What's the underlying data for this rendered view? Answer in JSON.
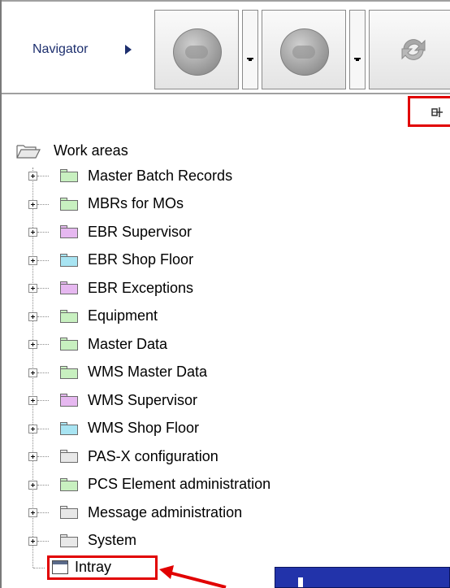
{
  "toolbar": {
    "navigator_label": "Navigator",
    "buttons": [
      {
        "name": "back",
        "has_dropdown": true
      },
      {
        "name": "forward",
        "has_dropdown": true
      },
      {
        "name": "refresh",
        "has_dropdown": false
      }
    ]
  },
  "tree": {
    "root": "Work areas",
    "items": [
      {
        "label": "Master Batch Records",
        "folder_color": "#c8f0c0"
      },
      {
        "label": "MBRs for MOs",
        "folder_color": "#c8f0c0"
      },
      {
        "label": "EBR Supervisor",
        "folder_color": "#e6b8f0"
      },
      {
        "label": "EBR Shop Floor",
        "folder_color": "#a8e4f2"
      },
      {
        "label": "EBR Exceptions",
        "folder_color": "#e6b8f0"
      },
      {
        "label": "Equipment",
        "folder_color": "#c8f0c0"
      },
      {
        "label": "Master Data",
        "folder_color": "#c8f0c0"
      },
      {
        "label": "WMS Master Data",
        "folder_color": "#c8f0c0"
      },
      {
        "label": "WMS Supervisor",
        "folder_color": "#e6b8f0"
      },
      {
        "label": "WMS Shop Floor",
        "folder_color": "#a8e4f2"
      },
      {
        "label": "PAS-X configuration",
        "folder_color": "#e8e8e8"
      },
      {
        "label": "PCS Element administration",
        "folder_color": "#c8f0c0"
      },
      {
        "label": "Message administration",
        "folder_color": "#e8e8e8"
      },
      {
        "label": "System",
        "folder_color": "#e8e8e8"
      }
    ],
    "leaf": {
      "label": "Intray"
    }
  },
  "colors": {
    "highlight": "#e10000",
    "tooltip_bg": "#2233aa",
    "nav_text": "#1d2f6e"
  }
}
